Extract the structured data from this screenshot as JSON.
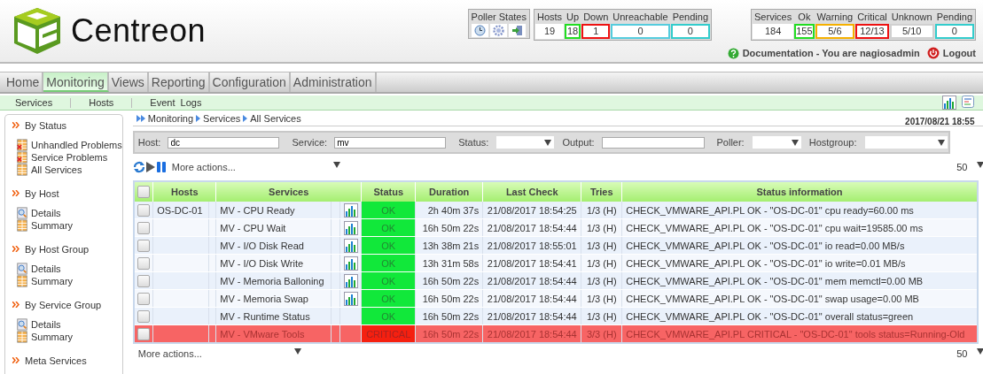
{
  "logo": {
    "name": "Centreon"
  },
  "poller_states": {
    "title": "Poller States"
  },
  "host_counters": [
    {
      "label": "Hosts",
      "value": "19"
    },
    {
      "label": "Up",
      "value": "18",
      "color": "#22dd22"
    },
    {
      "label": "Down",
      "value": "1",
      "color": "#ee1111"
    },
    {
      "label": "Unreachable",
      "value": "0",
      "color": "#55ccdd"
    },
    {
      "label": "Pending",
      "value": "0",
      "color": "#33cccc"
    }
  ],
  "service_counters": [
    {
      "label": "Services",
      "value": "184"
    },
    {
      "label": "Ok",
      "value": "155",
      "color": "#22dd22"
    },
    {
      "label": "Warning",
      "value": "5/6",
      "color": "#f5b000"
    },
    {
      "label": "Critical",
      "value": "12/13",
      "color": "#ee1111"
    },
    {
      "label": "Unknown",
      "value": "5/10",
      "color": "#d0d0d0"
    },
    {
      "label": "Pending",
      "value": "0",
      "color": "#33cccc"
    }
  ],
  "user_bar": {
    "documentation": "Documentation - You are nagiosadmin",
    "logout": "Logout"
  },
  "main_menu": [
    {
      "label": "Home",
      "selected": false
    },
    {
      "label": "Monitoring",
      "selected": true
    },
    {
      "label": "Views",
      "selected": false
    },
    {
      "label": "Reporting",
      "selected": false
    },
    {
      "label": "Configuration",
      "selected": false
    },
    {
      "label": "Administration",
      "selected": false
    }
  ],
  "sub_menu": [
    {
      "label": "Services"
    },
    {
      "label": "Hosts"
    },
    {
      "label": "Event  Logs"
    }
  ],
  "sidebar": [
    {
      "title": "By Status",
      "items": [
        {
          "label": "Unhandled Problems",
          "kind": "problems"
        },
        {
          "label": "Service Problems",
          "kind": "problems"
        },
        {
          "label": "All Services",
          "kind": "all"
        }
      ]
    },
    {
      "title": "By Host",
      "items": [
        {
          "label": "Details",
          "kind": "details"
        },
        {
          "label": "Summary",
          "kind": "summary"
        }
      ]
    },
    {
      "title": "By Host Group",
      "items": [
        {
          "label": "Details",
          "kind": "details"
        },
        {
          "label": "Summary",
          "kind": "summary"
        }
      ]
    },
    {
      "title": "By Service Group",
      "items": [
        {
          "label": "Details",
          "kind": "details"
        },
        {
          "label": "Summary",
          "kind": "summary"
        }
      ]
    },
    {
      "title": "Meta Services"
    }
  ],
  "breadcrumb": [
    "Monitoring",
    "Services",
    "All Services"
  ],
  "date": "2017/08/21 18:55",
  "filters": [
    {
      "label": "Host:",
      "kind": "text",
      "value": "dc"
    },
    {
      "label": "Service:",
      "kind": "text",
      "value": "mv"
    },
    {
      "label": "Status:",
      "kind": "select"
    },
    {
      "label": "Output:",
      "kind": "text"
    },
    {
      "label": "Poller:",
      "kind": "select"
    },
    {
      "label": "Hostgroup:",
      "kind": "select"
    }
  ],
  "actions": {
    "more_actions": "More actions...",
    "page_size": "50"
  },
  "table": {
    "all_checked": false,
    "columns": [
      "Hosts",
      "Services",
      "Status",
      "Duration",
      "Last Check",
      "Tries",
      "Status information"
    ],
    "rows": [
      {
        "checked": false,
        "host": "OS-DC-01",
        "service": "MV - CPU Ready",
        "graph": true,
        "status": "OK",
        "kind": "ok",
        "duration": "2h 40m 37s",
        "last_check": "21/08/2017 18:54:25",
        "tries": "1/3 (H)",
        "info": "CHECK_VMWARE_API.PL OK - \"OS-DC-01\" cpu ready=60.00 ms"
      },
      {
        "checked": false,
        "service": "MV - CPU Wait",
        "graph": true,
        "status": "OK",
        "kind": "ok",
        "duration": "16h 50m 22s",
        "last_check": "21/08/2017 18:54:44",
        "tries": "1/3 (H)",
        "info": "CHECK_VMWARE_API.PL OK - \"OS-DC-01\" cpu wait=19585.00 ms"
      },
      {
        "checked": false,
        "service": "MV - I/O Disk Read",
        "graph": true,
        "status": "OK",
        "kind": "ok",
        "duration": "13h 38m 21s",
        "last_check": "21/08/2017 18:55:01",
        "tries": "1/3 (H)",
        "info": "CHECK_VMWARE_API.PL OK - \"OS-DC-01\" io read=0.00 MB/s"
      },
      {
        "checked": false,
        "service": "MV - I/O Disk Write",
        "graph": true,
        "status": "OK",
        "kind": "ok",
        "duration": "13h 31m 58s",
        "last_check": "21/08/2017 18:54:41",
        "tries": "1/3 (H)",
        "info": "CHECK_VMWARE_API.PL OK - \"OS-DC-01\" io write=0.01 MB/s"
      },
      {
        "checked": false,
        "service": "MV - Memoria Balloning",
        "graph": true,
        "status": "OK",
        "kind": "ok",
        "duration": "16h 50m 22s",
        "last_check": "21/08/2017 18:54:44",
        "tries": "1/3 (H)",
        "info": "CHECK_VMWARE_API.PL OK - \"OS-DC-01\" mem memctl=0.00 MB"
      },
      {
        "checked": false,
        "service": "MV - Memoria Swap",
        "graph": true,
        "status": "OK",
        "kind": "ok",
        "duration": "16h 50m 22s",
        "last_check": "21/08/2017 18:54:44",
        "tries": "1/3 (H)",
        "info": "CHECK_VMWARE_API.PL OK - \"OS-DC-01\" swap usage=0.00 MB"
      },
      {
        "checked": false,
        "service": "MV - Runtime Status",
        "graph": false,
        "status": "OK",
        "kind": "ok",
        "duration": "16h 50m 22s",
        "last_check": "21/08/2017 18:54:44",
        "tries": "1/3 (H)",
        "info": "CHECK_VMWARE_API.PL OK - \"OS-DC-01\" overall status=green"
      },
      {
        "checked": false,
        "service": "MV - VMware Tools",
        "graph": false,
        "status": "CRITICAL",
        "kind": "critical",
        "duration": "16h 50m 22s",
        "last_check": "21/08/2017 18:54:44",
        "tries": "3/3 (H)",
        "info": "CHECK_VMWARE_API.PL CRITICAL - \"OS-DC-01\" tools status=Running-Old"
      }
    ]
  },
  "footer": {
    "more_actions": "More actions...",
    "page_size": "50"
  }
}
